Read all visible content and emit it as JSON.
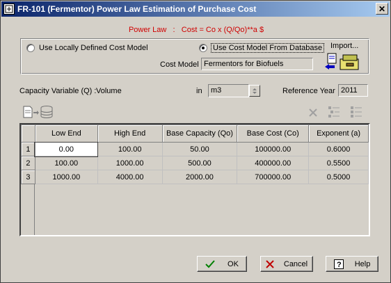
{
  "window": {
    "title": "FR-101 (Fermentor) Power Law Estimation of Purchase Cost",
    "close_glyph": "✕"
  },
  "power_law": {
    "label": "Power Law",
    "sep": ":",
    "formula": "Cost = Co x (Q/Qo)**a  $"
  },
  "cost_model": {
    "option_local": "Use Locally Defined Cost Model",
    "option_database": "Use Cost Model From Database",
    "selected": "database",
    "model_label": "Cost Model",
    "model_value": "Fermentors for Biofuels",
    "import_label": "Import..."
  },
  "capacity": {
    "label": "Capacity Variable (Q) :",
    "value": "Volume",
    "in_label": "in",
    "unit": "m3",
    "ref_year_label": "Reference Year",
    "ref_year": "2011"
  },
  "table": {
    "columns": [
      "Low End",
      "High End",
      "Base Capacity (Qo)",
      "Base Cost (Co)",
      "Exponent (a)"
    ],
    "rows": [
      {
        "num": "1",
        "cells": [
          "0.00",
          "100.00",
          "50.00",
          "100000.00",
          "0.6000"
        ]
      },
      {
        "num": "2",
        "cells": [
          "100.00",
          "1000.00",
          "500.00",
          "400000.00",
          "0.5500"
        ]
      },
      {
        "num": "3",
        "cells": [
          "1000.00",
          "4000.00",
          "2000.00",
          "700000.00",
          "0.5000"
        ]
      }
    ]
  },
  "buttons": {
    "ok": "OK",
    "cancel": "Cancel",
    "help": "Help"
  },
  "colors": {
    "accent_red": "#d00000",
    "title_bar": "#0a246a",
    "ok_check": "#008000",
    "cancel_x": "#c00000"
  }
}
